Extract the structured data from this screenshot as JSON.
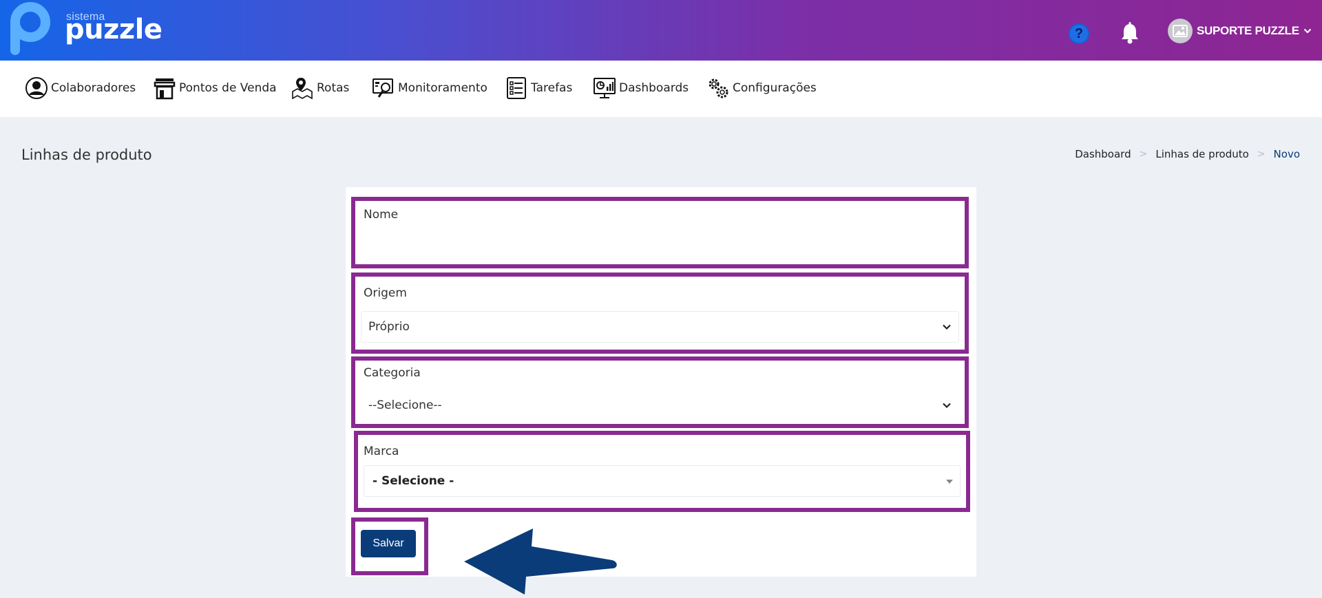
{
  "header": {
    "logo_small": "sistema",
    "logo_big": "puzzle",
    "help_glyph": "?",
    "user_name": "SUPORTE PUZZLE"
  },
  "nav": {
    "items": [
      {
        "label": "Colaboradores",
        "icon": "user-circle-icon"
      },
      {
        "label": "Pontos de Venda",
        "icon": "store-icon"
      },
      {
        "label": "Rotas",
        "icon": "map-pin-icon"
      },
      {
        "label": "Monitoramento",
        "icon": "monitor-search-icon"
      },
      {
        "label": "Tarefas",
        "icon": "checklist-icon"
      },
      {
        "label": "Dashboards",
        "icon": "dashboard-monitor-icon"
      },
      {
        "label": "Configurações",
        "icon": "gears-icon"
      }
    ]
  },
  "page": {
    "title": "Linhas de produto",
    "breadcrumb": [
      "Dashboard",
      "Linhas de produto",
      "Novo"
    ]
  },
  "form": {
    "nome_label": "Nome",
    "nome_value": "",
    "origem_label": "Origem",
    "origem_value": "Próprio",
    "categoria_label": "Categoria",
    "categoria_value": "--Selecione--",
    "marca_label": "Marca",
    "marca_value": "- Selecione -",
    "save_label": "Salvar"
  },
  "colors": {
    "header_start": "#1565e8",
    "header_end": "#8e2592",
    "highlight_border": "#8a2a91",
    "primary_button": "#0b3c7a",
    "arrow": "#0b3c7a"
  }
}
